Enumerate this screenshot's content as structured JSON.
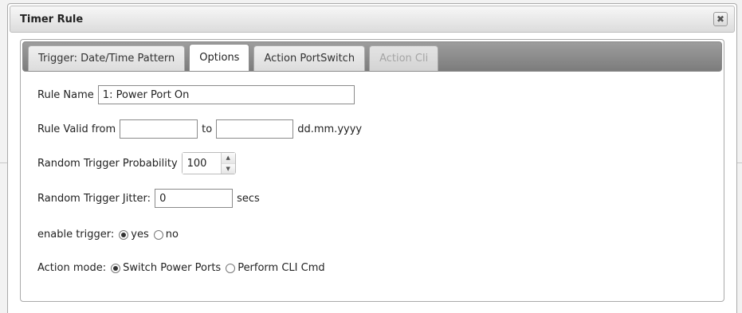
{
  "dialog": {
    "title": "Timer Rule",
    "close_glyph": "✖"
  },
  "tabs": [
    {
      "label": "Trigger: Date/Time Pattern",
      "state": "normal"
    },
    {
      "label": "Options",
      "state": "active"
    },
    {
      "label": "Action PortSwitch",
      "state": "normal"
    },
    {
      "label": "Action Cli",
      "state": "disabled"
    }
  ],
  "form": {
    "rule_name": {
      "label": "Rule Name",
      "value": "1: Power Port On"
    },
    "valid": {
      "label": "Rule Valid from",
      "from_value": "",
      "to_label": "to",
      "to_value": "",
      "format_hint": "dd.mm.yyyy"
    },
    "probability": {
      "label": "Random Trigger Probability",
      "value": "100"
    },
    "jitter": {
      "label": "Random Trigger Jitter:",
      "value": "0",
      "unit": "secs"
    },
    "enable": {
      "label": "enable trigger:",
      "options": [
        "yes",
        "no"
      ],
      "selected": "yes"
    },
    "action_mode": {
      "label": "Action mode:",
      "options": [
        "Switch Power Ports",
        "Perform CLI Cmd"
      ],
      "selected": "Switch Power Ports"
    }
  },
  "icons": {
    "close": "close-icon",
    "spin_up": "chevron-up-icon",
    "spin_down": "chevron-down-icon"
  }
}
